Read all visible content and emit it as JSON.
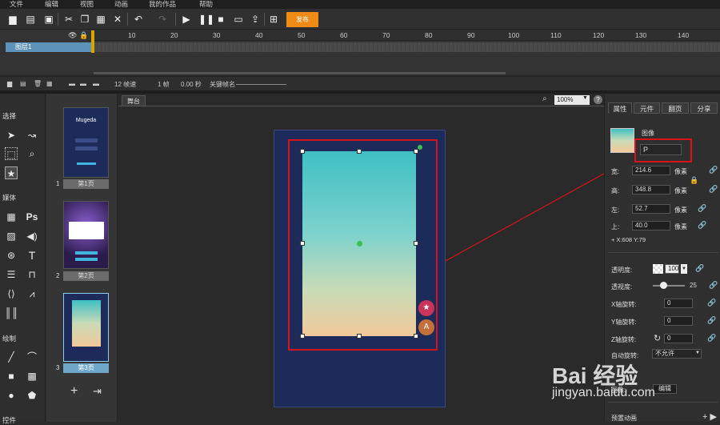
{
  "menu": [
    "文件",
    "编辑",
    "视图",
    "动画",
    "我的作品",
    "帮助"
  ],
  "toolbar": {
    "publish": "发布"
  },
  "timeline": {
    "ticks": [
      "10",
      "20",
      "30",
      "40",
      "50",
      "60",
      "70",
      "80",
      "90",
      "100",
      "110",
      "120",
      "130",
      "140"
    ],
    "layer": "图层1"
  },
  "timeline_footer": {
    "fps": "12 帧速",
    "frame": "1 帧",
    "seconds": "0.00 秒",
    "keyframe_label": "关键帧名"
  },
  "tools": {
    "select": "选择",
    "media": "媒体",
    "draw": "绘制",
    "widgets": "控件"
  },
  "pages": [
    {
      "num": "1",
      "label": "第1页",
      "app": "Mugeda"
    },
    {
      "num": "2",
      "label": "第2页"
    },
    {
      "num": "3",
      "label": "第3页"
    }
  ],
  "stage": {
    "tab": "舞台",
    "zoom": "100%"
  },
  "props": {
    "tabs": [
      "属性",
      "元件",
      "翻页",
      "分享"
    ],
    "type": "图像",
    "name_value": "P",
    "width_label": "宽:",
    "width": "214.6",
    "height_label": "高:",
    "height": "348.8",
    "left_label": "左:",
    "left": "52.7",
    "top_label": "上:",
    "top": "40.0",
    "unit": "像素",
    "xy": "+ X:608   Y:79",
    "opacity_label": "透明度:",
    "opacity": "100",
    "blur_label": "透视度:",
    "blur": "25",
    "xrot_label": "X轴旋转:",
    "xrot": "0",
    "yrot_label": "Y轴旋转:",
    "yrot": "0",
    "zrot_label": "Z轴旋转:",
    "zrot": "0",
    "auto_rot_label": "自动旋转:",
    "auto_rot": "不允许",
    "image_label": "图像:",
    "edit": "编辑",
    "preset_label": "预置动画"
  },
  "watermark": {
    "brand": "Bai 经验",
    "url": "jingyan.baidu.com"
  }
}
